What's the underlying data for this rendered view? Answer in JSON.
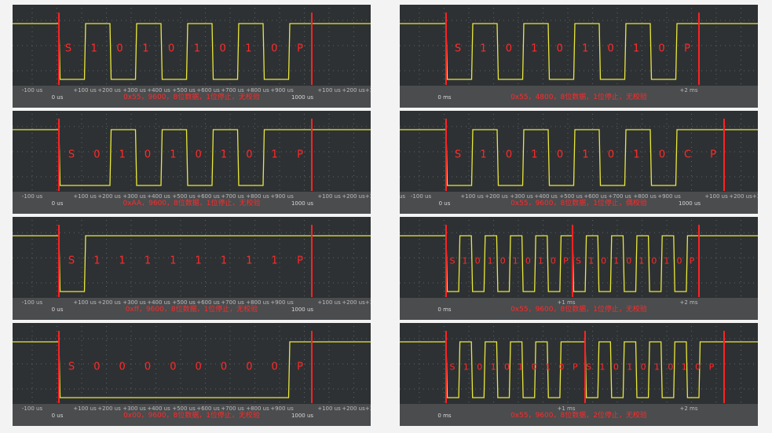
{
  "colors": {
    "background": "#2e3133",
    "signal": "#e8e83a",
    "marker": "#ff2222",
    "grid": "#556468",
    "caption": "#ff2a2a"
  },
  "panels": [
    {
      "name": "panel-0x55-9600",
      "bits": [
        "S",
        "1",
        "0",
        "1",
        "0",
        "1",
        "0",
        "1",
        "0",
        "P"
      ],
      "ticks": [
        "-100 us",
        "+100 us",
        "+200 us",
        "+300 us",
        "+400 us",
        "+500 us",
        "+600 us",
        "+700 us",
        "+800 us",
        "+900 us",
        "+100 us",
        "+200 us",
        "+3"
      ],
      "zero": "0 us",
      "end": "1000 us",
      "caption": "0x55，9600，8位数据，1位停止，无校验"
    },
    {
      "name": "panel-0x55-4800",
      "bits": [
        "S",
        "1",
        "0",
        "1",
        "0",
        "1",
        "0",
        "1",
        "0",
        "P"
      ],
      "ticks": [
        "+2 ms"
      ],
      "zero": "0 ms",
      "end": "",
      "caption": "0x55，4800，8位数据，1位停止，无校验"
    },
    {
      "name": "panel-0xaa-9600",
      "bits": [
        "S",
        "0",
        "1",
        "0",
        "1",
        "0",
        "1",
        "0",
        "1",
        "P"
      ],
      "ticks": [
        "-100 us",
        "+100 us",
        "+200 us",
        "+300 us",
        "+400 us",
        "+500 us",
        "+600 us",
        "+700 us",
        "+800 us",
        "+900 us",
        "+100 us",
        "+200 us",
        "+3"
      ],
      "zero": "0 us",
      "end": "1000 us",
      "caption": "0xAA，9600，8位数据，1位停止，无校验"
    },
    {
      "name": "panel-0x55-9600-odd",
      "bits": [
        "S",
        "1",
        "0",
        "1",
        "0",
        "1",
        "0",
        "1",
        "0",
        "C",
        "P"
      ],
      "ticks": [
        "us",
        "-100 us",
        "+100 us",
        "+200 us",
        "+300 us",
        "+400 us",
        "+500 us",
        "+600 us",
        "+700 us",
        "+800 us",
        "+900 us",
        "+100 us",
        "+200 us",
        "+3"
      ],
      "zero": "0 us",
      "end": "1000 us",
      "caption": "0x55，9600，8位数据，1位停止，偶校验"
    },
    {
      "name": "panel-0xff-9600",
      "bits": [
        "S",
        "1",
        "1",
        "1",
        "1",
        "1",
        "1",
        "1",
        "1",
        "P"
      ],
      "ticks": [
        "-100 us",
        "+100 us",
        "+200 us",
        "+300 us",
        "+400 us",
        "+500 us",
        "+600 us",
        "+700 us",
        "+800 us",
        "+900 us",
        "+100 us",
        "+200 us",
        "+3"
      ],
      "zero": "0 us",
      "end": "1000 us",
      "caption": "0xff，9600，8位数据，1位停止，无校验"
    },
    {
      "name": "panel-0x55-double",
      "bits": [
        "S",
        "1",
        "0",
        "1",
        "0",
        "1",
        "0",
        "1",
        "0",
        "P",
        "S",
        "1",
        "0",
        "1",
        "0",
        "1",
        "0",
        "1",
        "0",
        "P"
      ],
      "ticks": [
        "+1 ms",
        "+2 ms"
      ],
      "zero": "0 ms",
      "end": "",
      "caption": "0x55，9600，8位数据，1位停止，无校验"
    },
    {
      "name": "panel-0x00-9600",
      "bits": [
        "S",
        "0",
        "0",
        "0",
        "0",
        "0",
        "0",
        "0",
        "0",
        "P"
      ],
      "ticks": [
        "-100 us",
        "+100 us",
        "+200 us",
        "+300 us",
        "+400 us",
        "+500 us",
        "+600 us",
        "+700 us",
        "+800 us",
        "+900 us",
        "+100 us",
        "+200 us",
        "+3"
      ],
      "zero": "0 us",
      "end": "1000 us",
      "caption": "0x00，9600，8位数据，1位停止，无校验"
    },
    {
      "name": "panel-0x55-2stop",
      "bits": [
        "S",
        "1",
        "0",
        "1",
        "0",
        "1",
        "0",
        "1",
        "0",
        "P",
        "S",
        "1",
        "0",
        "1",
        "0",
        "1",
        "0",
        "1",
        "0",
        "P"
      ],
      "ticks": [
        "+1 ms",
        "+2 ms"
      ],
      "zero": "0 ms",
      "end": "",
      "caption": "0x55，9600，8位数据，2位停止，无校验"
    }
  ]
}
